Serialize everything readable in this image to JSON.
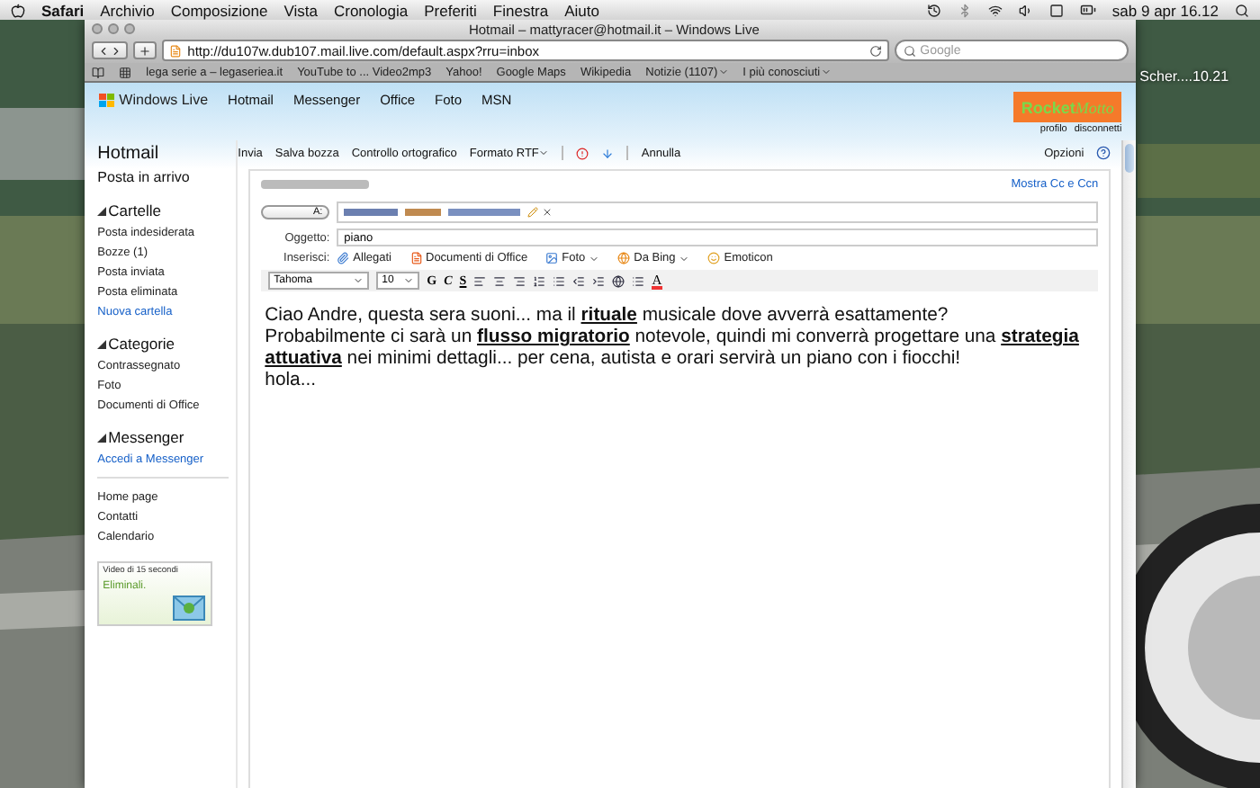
{
  "menubar": {
    "app": "Safari",
    "menus": [
      "Archivio",
      "Composizione",
      "Vista",
      "Cronologia",
      "Preferiti",
      "Finestra",
      "Aiuto"
    ],
    "clock": "sab 9 apr 16.12"
  },
  "desktop": {
    "file_label": "Scher....10.21"
  },
  "browser": {
    "title": "Hotmail – mattyracer@hotmail.it – Windows Live",
    "url": "http://du107w.dub107.mail.live.com/default.aspx?rru=inbox",
    "search_placeholder": "Google",
    "bookmarks": [
      {
        "label": "lega serie a – legaseriea.it",
        "menu": false
      },
      {
        "label": "YouTube to ... Video2mp3",
        "menu": false
      },
      {
        "label": "Yahoo!",
        "menu": false
      },
      {
        "label": "Google Maps",
        "menu": false
      },
      {
        "label": "Wikipedia",
        "menu": false
      },
      {
        "label": "Notizie (1107)",
        "menu": true
      },
      {
        "label": "I più conosciuti",
        "menu": true
      }
    ]
  },
  "header": {
    "brand": "Windows Live",
    "nav": [
      "Hotmail",
      "Messenger",
      "Office",
      "Foto",
      "MSN"
    ],
    "logo_a": "Rocket",
    "logo_b": "Motto",
    "profile": "profilo",
    "logout": "disconnetti"
  },
  "toolbar": {
    "items": [
      {
        "label": "Invia",
        "menu": false
      },
      {
        "label": "Salva bozza",
        "menu": false
      },
      {
        "label": "Controllo ortografico",
        "menu": false
      },
      {
        "label": "Formato RTF",
        "menu": true
      }
    ],
    "cancel": "Annulla",
    "options": "Opzioni"
  },
  "sidebar": {
    "title": "Hotmail",
    "inbox": "Posta in arrivo",
    "sections": [
      {
        "title": "Cartelle",
        "expanded": true,
        "items": [
          {
            "label": "Posta indesiderata",
            "kind": "folder"
          },
          {
            "label": "Bozze (1)",
            "kind": "folder"
          },
          {
            "label": "Posta inviata",
            "kind": "folder"
          },
          {
            "label": "Posta eliminata",
            "kind": "folder"
          },
          {
            "label": "Nuova cartella",
            "kind": "link"
          }
        ]
      },
      {
        "title": "Categorie",
        "expanded": true,
        "items": [
          {
            "label": "Contrassegnato",
            "kind": "folder"
          },
          {
            "label": "Foto",
            "kind": "folder"
          },
          {
            "label": "Documenti di Office",
            "kind": "folder"
          }
        ]
      },
      {
        "title": "Messenger",
        "expanded": true,
        "items": [
          {
            "label": "Accedi a Messenger",
            "kind": "link"
          }
        ]
      }
    ],
    "links": [
      "Home page",
      "Contatti",
      "Calendario"
    ],
    "ad": {
      "caption": "Video di 15 secondi",
      "headline": "Eliminali."
    }
  },
  "compose": {
    "show_cc": "Mostra Cc e Ccn",
    "to_label": "A:",
    "subject_label": "Oggetto:",
    "subject": "piano",
    "insert_label": "Inserisci:",
    "insert": [
      {
        "label": "Allegati",
        "kind": "clip",
        "menu": false
      },
      {
        "label": "Documenti di Office",
        "kind": "office",
        "menu": false
      },
      {
        "label": "Foto",
        "menu": true
      },
      {
        "label": "Da Bing",
        "kind": "bing",
        "menu": true
      },
      {
        "label": "Emoticon",
        "kind": "smile",
        "menu": false
      }
    ],
    "font": "Tahoma",
    "size": "10",
    "styles": [
      "G",
      "C",
      "S"
    ],
    "color_letter": "A",
    "body": [
      "Ciao Andre, questa sera suoni... ma il **rituale** musicale dove avverrà esattamente?",
      "Probabilmente ci sarà un **flusso migratorio** notevole, quindi mi converrà progettare una **strategia attuativa** nei minimi dettagli... per cena, autista e orari servirà un piano con i fiocchi!",
      "hola..."
    ]
  }
}
